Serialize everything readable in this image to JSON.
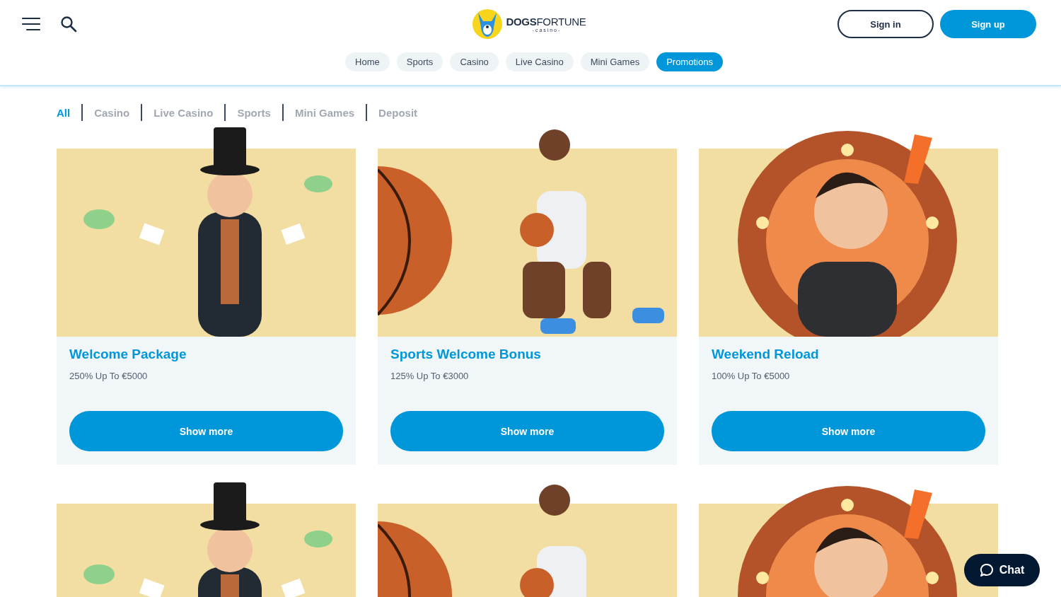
{
  "header": {
    "logo": {
      "brand": "**DOGS**FORTUNE",
      "sub": "- c a s i n o -"
    },
    "nav": [
      {
        "label": "Home",
        "selected": false
      },
      {
        "label": "Sports",
        "selected": false
      },
      {
        "label": "Casino",
        "selected": false
      },
      {
        "label": "Live Casino",
        "selected": false
      },
      {
        "label": "Mini Games",
        "selected": false
      },
      {
        "label": "Promotions",
        "selected": true
      }
    ],
    "sign_in": "Sign in",
    "sign_up": "Sign up"
  },
  "filters": [
    {
      "label": "All",
      "selected": true
    },
    {
      "label": "Casino",
      "selected": false
    },
    {
      "label": "Live Casino",
      "selected": false
    },
    {
      "label": "Sports",
      "selected": false
    },
    {
      "label": "Mini Games",
      "selected": false
    },
    {
      "label": "Deposit",
      "selected": false
    }
  ],
  "promos": [
    {
      "kind": "offer",
      "title": "Welcome Package",
      "subtitle": "250% Up To €5000",
      "button": "Show more"
    },
    {
      "kind": "offer",
      "title": "Sports Welcome Bonus",
      "subtitle": "125% Up To €3000",
      "button": "Show more"
    },
    {
      "kind": "offer",
      "title": "Weekend Reload",
      "subtitle": "100% Up To €5000",
      "button": "Show more"
    },
    {
      "kind": "picture"
    },
    {
      "kind": "picture"
    },
    {
      "kind": "picture"
    }
  ],
  "chat": {
    "label": "Chat"
  }
}
